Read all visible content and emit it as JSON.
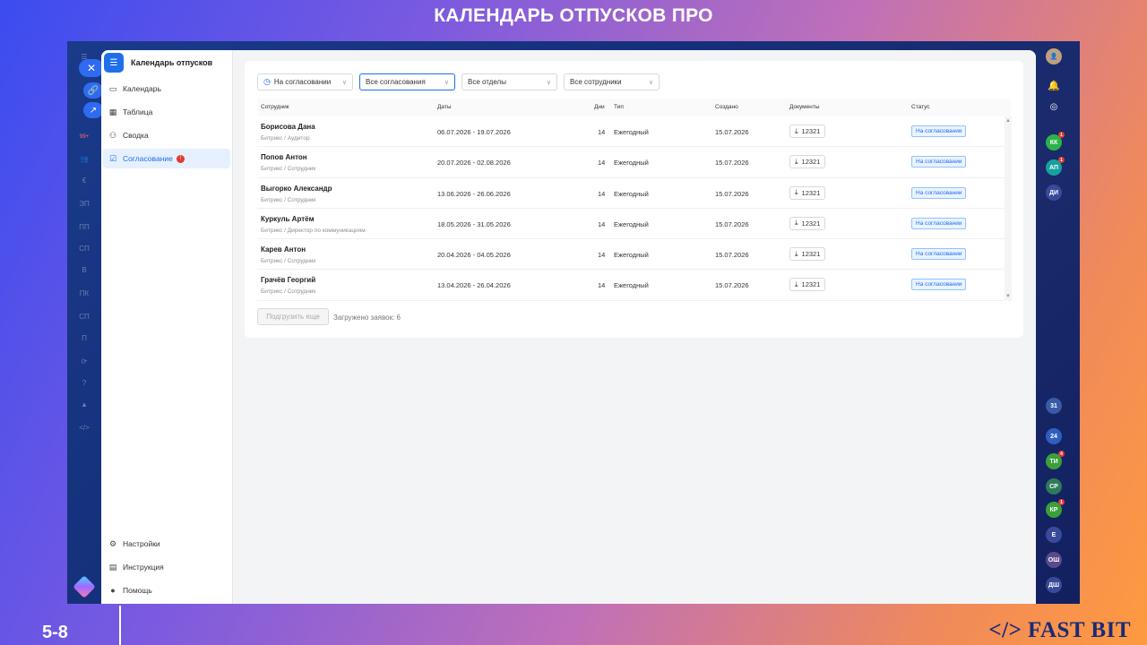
{
  "slide": {
    "title": "КАЛЕНДАРЬ ОТПУСКОВ ПРО",
    "page_number": "5-8",
    "brand": "</> FAST BIT"
  },
  "app": {
    "title": "Календарь отпусков",
    "nav": [
      {
        "label": "Календарь",
        "icon": "calendar-icon"
      },
      {
        "label": "Таблица",
        "icon": "table-icon"
      },
      {
        "label": "Сводка",
        "icon": "summary-icon"
      },
      {
        "label": "Согласование",
        "icon": "approval-icon",
        "badge": "!"
      }
    ],
    "bottom_nav": [
      {
        "label": "Настройки",
        "icon": "gear-icon"
      },
      {
        "label": "Инструкция",
        "icon": "book-icon"
      },
      {
        "label": "Помощь",
        "icon": "help-icon"
      }
    ]
  },
  "filters": {
    "status": "На согласовании",
    "approvals": "Все согласования",
    "departments": "Все отделы",
    "employees": "Все сотрудники"
  },
  "table": {
    "headers": {
      "employee": "Сотрудник",
      "dates": "Даты",
      "days": "Дни",
      "type": "Тип",
      "created": "Создано",
      "documents": "Документы",
      "status": "Статус"
    },
    "rows": [
      {
        "name": "Борисова Дана",
        "role": "Битрикс / Аудитор",
        "dates": "06.07.2026 - 19.07.2026",
        "days": "14",
        "type": "Ежегодный",
        "created": "15.07.2026",
        "doc": "12321",
        "status": "На согласовании"
      },
      {
        "name": "Попов Антон",
        "role": "Битрикс / Сотрудник",
        "dates": "20.07.2026 - 02.08.2026",
        "days": "14",
        "type": "Ежегодный",
        "created": "15.07.2026",
        "doc": "12321",
        "status": "На согласовании"
      },
      {
        "name": "Выгорко Александр",
        "role": "Битрикс / Сотрудник",
        "dates": "13.06.2026 - 26.06.2026",
        "days": "14",
        "type": "Ежегодный",
        "created": "15.07.2026",
        "doc": "12321",
        "status": "На согласовании"
      },
      {
        "name": "Куркуль Артём",
        "role": "Битрикс / Директор по коммуникациям",
        "dates": "18.05.2026 - 31.05.2026",
        "days": "14",
        "type": "Ежегодный",
        "created": "15.07.2026",
        "doc": "12321",
        "status": "На согласовании"
      },
      {
        "name": "Карев Антон",
        "role": "Битрикс / Сотрудник",
        "dates": "20.04.2026 - 04.05.2026",
        "days": "14",
        "type": "Ежегодный",
        "created": "15.07.2026",
        "doc": "12321",
        "status": "На согласовании"
      },
      {
        "name": "Грачёв Георгий",
        "role": "Битрикс / Сотрудник",
        "dates": "13.04.2026 - 26.04.2026",
        "days": "14",
        "type": "Ежегодный",
        "created": "15.07.2026",
        "doc": "12321",
        "status": "На согласовании"
      }
    ]
  },
  "footer": {
    "load_more": "Подгрузить еще",
    "loaded": "Загружено заявок: 6"
  },
  "left_rail": {
    "labels": [
      "99+",
      "ЭП",
      "ПП",
      "СП",
      "В",
      "ПК",
      "СП",
      "П"
    ]
  },
  "right_rail": {
    "avatars": [
      {
        "text": "КК",
        "color": "#2bb34a",
        "badge": "1"
      },
      {
        "text": "АП",
        "color": "#18a0a0",
        "badge": "1"
      },
      {
        "text": "ДИ",
        "color": "#3a4a9a",
        "badge": ""
      },
      {
        "text": "31",
        "color": "#3a5aa8",
        "badge": ""
      },
      {
        "text": "24",
        "color": "#2f5fc0",
        "badge": ""
      },
      {
        "text": "ТИ",
        "color": "#3aa03a",
        "badge": "4"
      },
      {
        "text": "СР",
        "color": "#2f7a5a",
        "badge": ""
      },
      {
        "text": "КР",
        "color": "#3aa03a",
        "badge": "1"
      },
      {
        "text": "Е",
        "color": "#3a4a9a",
        "badge": ""
      },
      {
        "text": "ОШ",
        "color": "#5a4a8a",
        "badge": ""
      },
      {
        "text": "ДШ",
        "color": "#3a4a9a",
        "badge": ""
      }
    ]
  },
  "colors": {
    "accent": "#1f6feb",
    "status_bg": "#eaf3ff",
    "badge_red": "#e53935"
  }
}
